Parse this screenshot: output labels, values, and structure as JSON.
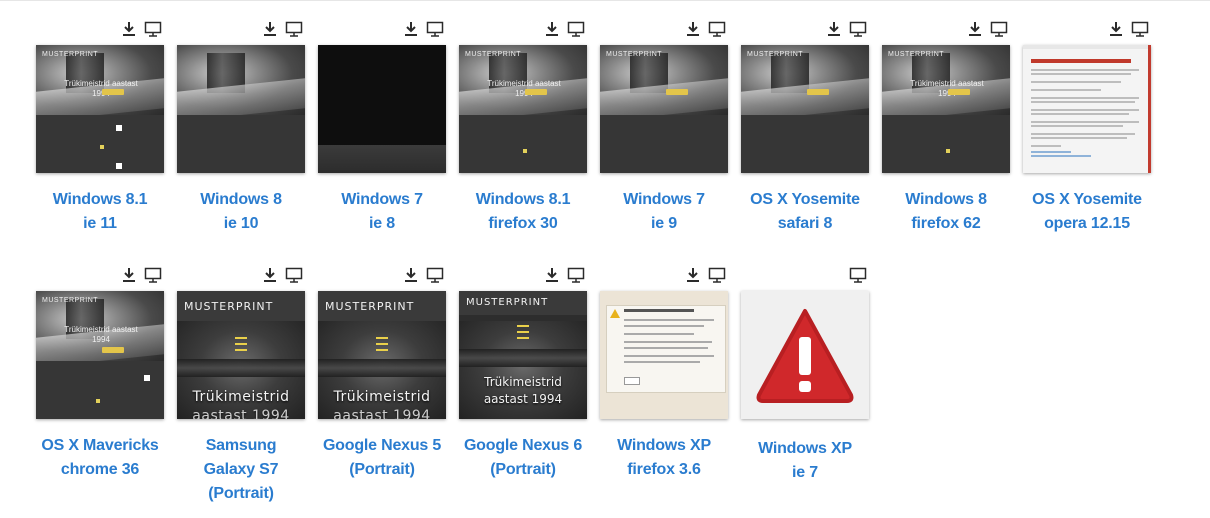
{
  "icons": {
    "download": "download-icon",
    "monitor": "monitor-icon",
    "color": "#2b2b2b"
  },
  "link_color": "#2a7ccf",
  "screenshots": [
    {
      "line1": "Windows 8.1",
      "line2": "ie 11",
      "thumb": "desktop",
      "thumb_text": "Trükimeistrid aastast 1994",
      "thumb_brand": "MUSTERPRINT",
      "has_download": true
    },
    {
      "line1": "Windows 8",
      "line2": "ie 10",
      "thumb": "desktop",
      "thumb_text": "",
      "thumb_brand": "",
      "has_download": true
    },
    {
      "line1": "Windows 7",
      "line2": "ie 8",
      "thumb": "black",
      "has_download": true
    },
    {
      "line1": "Windows 8.1",
      "line2": "firefox 30",
      "thumb": "desktop",
      "thumb_text": "Trükimeistrid aastast 1994",
      "thumb_brand": "MUSTERPRINT",
      "has_download": true
    },
    {
      "line1": "Windows 7",
      "line2": "ie 9",
      "thumb": "desktop",
      "thumb_text": "",
      "thumb_brand": "MUSTERPRINT",
      "has_download": true
    },
    {
      "line1": "OS X Yosemite",
      "line2": "safari 8",
      "thumb": "desktop",
      "thumb_text": "",
      "thumb_brand": "MUSTERPRINT",
      "has_download": true
    },
    {
      "line1": "Windows 8",
      "line2": "firefox 62",
      "thumb": "desktop",
      "thumb_text": "Trükimeistrid aastast 1994",
      "thumb_brand": "MUSTERPRINT",
      "has_download": true
    },
    {
      "line1": "OS X Yosemite",
      "line2": "opera 12.15",
      "thumb": "error-page",
      "has_download": true
    },
    {
      "line1": "OS X Mavericks",
      "line2": "chrome 36",
      "thumb": "desktop",
      "thumb_text": "Trükimeistrid aastast 1994",
      "thumb_brand": "MUSTERPRINT",
      "has_download": true
    },
    {
      "line1": "Samsung",
      "line2": "Galaxy S7",
      "line3": "(Portrait)",
      "thumb": "mobile",
      "thumb_brand": "MUSTERPRINT",
      "thumb_text": "Trükimeistrid",
      "thumb_text2": "aastast 1994",
      "has_download": true
    },
    {
      "line1": "Google Nexus 5",
      "line2": "(Portrait)",
      "thumb": "mobile",
      "thumb_brand": "MUSTERPRINT",
      "thumb_text": "Trükimeistrid",
      "thumb_text2": "aastast 1994",
      "has_download": true
    },
    {
      "line1": "Google Nexus 6",
      "line2": "(Portrait)",
      "thumb": "mobile",
      "thumb_brand": "MUSTERPRINT",
      "thumb_text": "Trükimeistrid",
      "thumb_text2": "aastast 1994",
      "has_download": true
    },
    {
      "line1": "Windows XP",
      "line2": "firefox 3.6",
      "thumb": "xp-dialog",
      "has_download": true
    },
    {
      "line1": "Windows XP",
      "line2": "ie 7",
      "thumb": "warning",
      "has_download": false
    }
  ]
}
